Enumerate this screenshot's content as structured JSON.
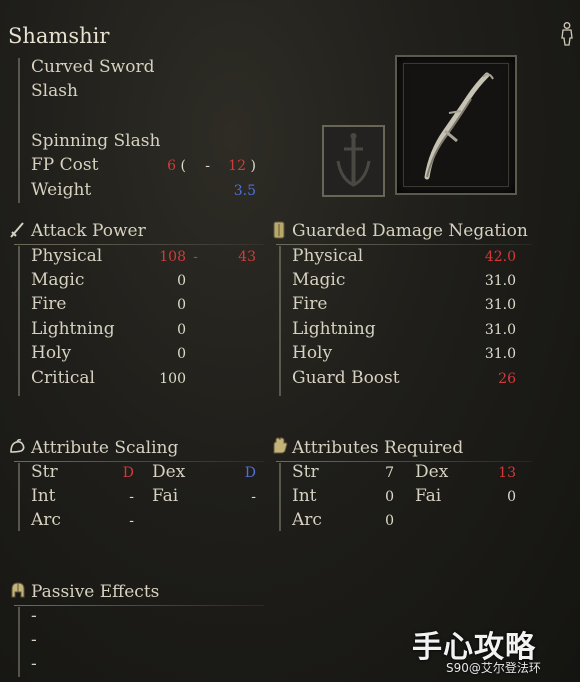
{
  "weapon": {
    "name": "Shamshir",
    "type": "Curved Sword",
    "damage_type": "Slash",
    "skill": "Spinning Slash",
    "fp_cost_label": "FP Cost",
    "fp_cost_a": "6",
    "fp_open": "(",
    "fp_dash": "-",
    "fp_cost_b": "12",
    "fp_close": ")",
    "weight_label": "Weight",
    "weight": "3.5"
  },
  "attack": {
    "header": "Attack Power",
    "rows": [
      {
        "label": "Physical",
        "value": "108",
        "sep": "-",
        "extra": "43"
      },
      {
        "label": "Magic",
        "value": "0"
      },
      {
        "label": "Fire",
        "value": "0"
      },
      {
        "label": "Lightning",
        "value": "0"
      },
      {
        "label": "Holy",
        "value": "0"
      },
      {
        "label": "Critical",
        "value": "100"
      }
    ]
  },
  "guard": {
    "header": "Guarded Damage Negation",
    "rows": [
      {
        "label": "Physical",
        "value": "42.0"
      },
      {
        "label": "Magic",
        "value": "31.0"
      },
      {
        "label": "Fire",
        "value": "31.0"
      },
      {
        "label": "Lightning",
        "value": "31.0"
      },
      {
        "label": "Holy",
        "value": "31.0"
      },
      {
        "label": "Guard Boost",
        "value": "26"
      }
    ]
  },
  "scaling": {
    "header": "Attribute Scaling",
    "str_label": "Str",
    "str": "D",
    "dex_label": "Dex",
    "dex": "D",
    "int_label": "Int",
    "int": "-",
    "fai_label": "Fai",
    "fai": "-",
    "arc_label": "Arc",
    "arc": "-"
  },
  "required": {
    "header": "Attributes Required",
    "str_label": "Str",
    "str": "7",
    "dex_label": "Dex",
    "dex": "13",
    "int_label": "Int",
    "int": "0",
    "fai_label": "Fai",
    "fai": "0",
    "arc_label": "Arc",
    "arc": "0"
  },
  "passive": {
    "header": "Passive Effects",
    "items": [
      "-",
      "-",
      "-"
    ]
  },
  "watermark": {
    "logo": "手心攻略",
    "sub": "S90@艾尔登法环"
  },
  "colors": {
    "red": "#d23a3a",
    "blue": "#4f6fd6",
    "text": "#d6d1c0"
  },
  "icons": {
    "top_right": "person-figure-icon",
    "attack": "sword-icon",
    "guard": "shield-icon",
    "scaling": "arm-icon",
    "required": "hand-icon",
    "passive": "helmet-icon",
    "skill": "ash-of-war-icon"
  }
}
